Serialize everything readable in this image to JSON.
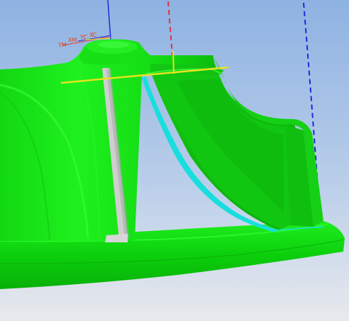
{
  "viewport": {
    "background_top": "#8fb3e3",
    "background_bottom": "#e6e8ec",
    "model_color": "#19e619",
    "blade_edge_color": "#17dede",
    "hub_seam_color": "#c8c8c8"
  },
  "triad": {
    "labels": [
      {
        "text": "YM"
      },
      {
        "text": "XM"
      },
      {
        "text": "YC"
      },
      {
        "text": "XC"
      }
    ],
    "label_color": "#e0401a"
  },
  "axes": {
    "z_axis_color": "#1a2ae0",
    "x_axis_color": "#e0e020",
    "y_axis_color": "#e0304a",
    "tool_axis_color": "#1a2ae0"
  },
  "scene_objects": {
    "model": "impeller-blade-model",
    "hub": "hub-surface",
    "blade": "blade-surface",
    "edge": "blade-leading-edge",
    "seam": "hub-seam-strip"
  }
}
